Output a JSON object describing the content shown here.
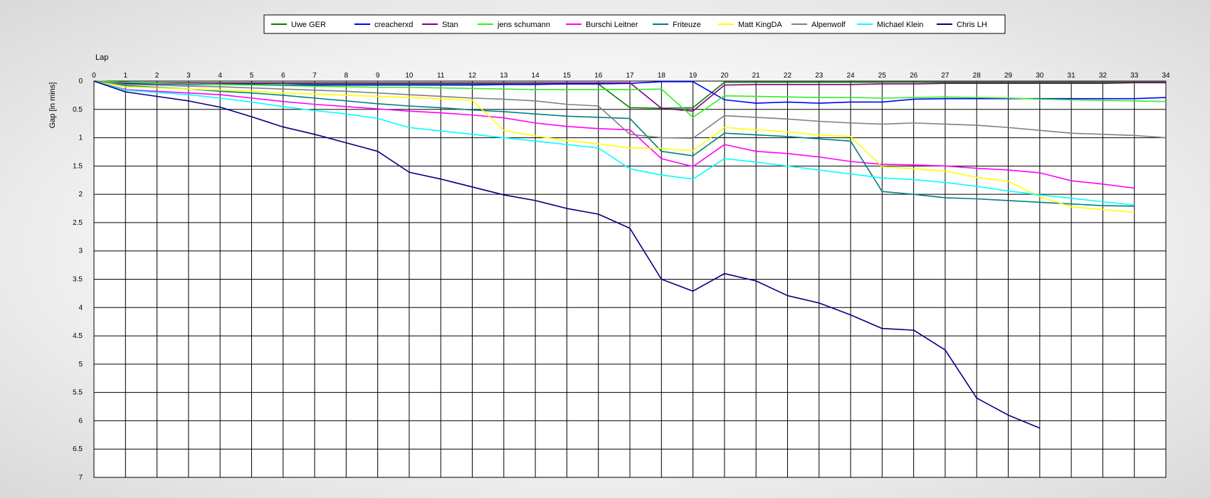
{
  "chart_data": {
    "type": "line",
    "xlabel": "Lap",
    "ylabel": "Gap [in mins]",
    "xlim": [
      0,
      34
    ],
    "ylim": [
      0,
      7
    ],
    "y_inverted": true,
    "x_ticks": [
      "0",
      "1",
      "2",
      "3",
      "4",
      "5",
      "6",
      "7",
      "8",
      "9",
      "10",
      "11",
      "12",
      "13",
      "14",
      "15",
      "16",
      "17",
      "18",
      "19",
      "20",
      "21",
      "22",
      "23",
      "24",
      "25",
      "26",
      "27",
      "28",
      "29",
      "30",
      "31",
      "32",
      "33",
      "34"
    ],
    "y_ticks": [
      "0",
      "0.5",
      "1",
      "1.5",
      "2",
      "2.5",
      "3",
      "3.5",
      "4",
      "4.5",
      "5",
      "5.5",
      "6",
      "6.5",
      "7"
    ],
    "grid": true,
    "legend_position": "top-center",
    "series": [
      {
        "name": "Uwe GER",
        "color": "#008000",
        "x": [
          0,
          1,
          2,
          3,
          4,
          5,
          6,
          7,
          8,
          9,
          10,
          11,
          12,
          13,
          14,
          15,
          16,
          17,
          18,
          19,
          20,
          21,
          22,
          23,
          24,
          25,
          26,
          27,
          28,
          29,
          30,
          31,
          32,
          33,
          34
        ],
        "y": [
          0,
          0.02,
          0.03,
          0.03,
          0.04,
          0.04,
          0.04,
          0.05,
          0.05,
          0.05,
          0.05,
          0.05,
          0.05,
          0.05,
          0.05,
          0.05,
          0.05,
          0.47,
          0.48,
          0.47,
          0.02,
          0.02,
          0.02,
          0.02,
          0.02,
          0.02,
          0.02,
          0.02,
          0.02,
          0.02,
          0.02,
          0.02,
          0.02,
          0.02,
          0.02
        ]
      },
      {
        "name": "creacherxd",
        "color": "#0000ff",
        "x": [
          0,
          1,
          2,
          3,
          4,
          5,
          6,
          7,
          8,
          9,
          10,
          11,
          12,
          13,
          14,
          15,
          16,
          17,
          18,
          19,
          20,
          21,
          22,
          23,
          24,
          25,
          26,
          27,
          28,
          29,
          30,
          31,
          32,
          33,
          34
        ],
        "y": [
          0,
          0.04,
          0.05,
          0.06,
          0.06,
          0.06,
          0.07,
          0.07,
          0.07,
          0.07,
          0.07,
          0.07,
          0.07,
          0.06,
          0.06,
          0.05,
          0.05,
          0.04,
          0.01,
          0.01,
          0.33,
          0.39,
          0.37,
          0.39,
          0.37,
          0.37,
          0.32,
          0.31,
          0.31,
          0.31,
          0.31,
          0.31,
          0.31,
          0.31,
          0.29
        ]
      },
      {
        "name": "Stan",
        "color": "#800080",
        "x": [
          0,
          1,
          2,
          3,
          4,
          5,
          6,
          7,
          8,
          9,
          10,
          11,
          12,
          13,
          14,
          15,
          16,
          17,
          18,
          19,
          20,
          21,
          22,
          23,
          24,
          25,
          26,
          27,
          28,
          29,
          30,
          31,
          32,
          33,
          34
        ],
        "y": [
          0,
          0.03,
          0.03,
          0.03,
          0.03,
          0.03,
          0.03,
          0.03,
          0.03,
          0.03,
          0.03,
          0.03,
          0.03,
          0.03,
          0.03,
          0.03,
          0.03,
          0.03,
          0.48,
          0.53,
          0.07,
          0.06,
          0.06,
          0.06,
          0.06,
          0.05,
          0.05,
          0.04,
          0.04,
          0.04,
          0.04,
          0.04,
          0.04,
          0.03,
          0.03
        ]
      },
      {
        "name": "jens  schumann",
        "color": "#33ee22",
        "x": [
          0,
          1,
          2,
          3,
          4,
          5,
          6,
          7,
          8,
          9,
          10,
          11,
          12,
          13,
          14,
          15,
          16,
          17,
          18,
          19,
          20,
          21,
          22,
          23,
          24,
          25,
          26,
          27,
          28,
          29,
          30,
          31,
          32,
          33,
          34
        ],
        "y": [
          0,
          0.02,
          0.04,
          0.05,
          0.06,
          0.07,
          0.08,
          0.09,
          0.1,
          0.11,
          0.11,
          0.12,
          0.13,
          0.14,
          0.15,
          0.15,
          0.15,
          0.15,
          0.14,
          0.64,
          0.26,
          0.27,
          0.28,
          0.29,
          0.29,
          0.3,
          0.29,
          0.28,
          0.29,
          0.3,
          0.32,
          0.33,
          0.34,
          0.35,
          0.36
        ]
      },
      {
        "name": "Burschi Leitner",
        "color": "#ff00ff",
        "x": [
          0,
          1,
          2,
          3,
          4,
          5,
          6,
          7,
          8,
          9,
          10,
          11,
          12,
          13,
          14,
          15,
          16,
          17,
          18,
          19,
          20,
          21,
          22,
          23,
          24,
          25,
          26,
          27,
          28,
          29,
          30,
          31,
          32,
          33
        ],
        "y": [
          0,
          0.15,
          0.18,
          0.21,
          0.24,
          0.3,
          0.36,
          0.41,
          0.45,
          0.49,
          0.53,
          0.56,
          0.6,
          0.65,
          0.74,
          0.8,
          0.84,
          0.86,
          1.37,
          1.51,
          1.12,
          1.24,
          1.28,
          1.34,
          1.42,
          1.47,
          1.48,
          1.5,
          1.54,
          1.57,
          1.62,
          1.76,
          1.82,
          1.89
        ]
      },
      {
        "name": "Friteuze",
        "color": "#008080",
        "x": [
          0,
          1,
          2,
          3,
          4,
          5,
          6,
          7,
          8,
          9,
          10,
          11,
          12,
          13,
          14,
          15,
          16,
          17,
          18,
          19,
          20,
          21,
          22,
          23,
          24,
          25,
          26,
          27,
          28,
          29,
          30,
          31,
          32,
          33
        ],
        "y": [
          0,
          0.08,
          0.11,
          0.14,
          0.18,
          0.21,
          0.25,
          0.3,
          0.35,
          0.4,
          0.44,
          0.47,
          0.51,
          0.54,
          0.58,
          0.62,
          0.64,
          0.66,
          1.24,
          1.32,
          0.92,
          0.95,
          0.98,
          1.02,
          1.06,
          1.95,
          2.0,
          2.06,
          2.08,
          2.11,
          2.14,
          2.17,
          2.2,
          2.21
        ]
      },
      {
        "name": "Matt KingDA",
        "color": "#ffff00",
        "x": [
          0,
          1,
          2,
          3,
          4,
          5,
          6,
          7,
          8,
          9,
          10,
          11,
          12,
          13,
          14,
          15,
          16,
          17,
          18,
          19,
          20,
          21,
          22,
          23,
          24,
          25,
          26,
          27,
          28,
          29,
          30,
          31,
          32,
          33
        ],
        "y": [
          0,
          0.1,
          0.12,
          0.14,
          0.16,
          0.18,
          0.21,
          0.23,
          0.25,
          0.27,
          0.29,
          0.31,
          0.34,
          0.87,
          0.97,
          1.05,
          1.11,
          1.18,
          1.19,
          1.23,
          0.82,
          0.86,
          0.9,
          0.95,
          0.98,
          1.51,
          1.55,
          1.59,
          1.7,
          1.77,
          2.04,
          2.22,
          2.27,
          2.32
        ]
      },
      {
        "name": "Alpenwolf",
        "color": "#808080",
        "x": [
          0,
          1,
          2,
          3,
          4,
          5,
          6,
          7,
          8,
          9,
          10,
          11,
          12,
          13,
          14,
          15,
          16,
          17,
          18,
          19,
          20,
          21,
          22,
          23,
          24,
          25,
          26,
          27,
          28,
          29,
          30,
          31,
          32,
          33,
          34
        ],
        "y": [
          0,
          0.06,
          0.07,
          0.09,
          0.1,
          0.12,
          0.14,
          0.16,
          0.18,
          0.21,
          0.24,
          0.27,
          0.3,
          0.32,
          0.35,
          0.41,
          0.44,
          0.94,
          1.0,
          1.01,
          0.61,
          0.64,
          0.67,
          0.71,
          0.74,
          0.76,
          0.74,
          0.76,
          0.78,
          0.82,
          0.87,
          0.92,
          0.94,
          0.96,
          1.0
        ]
      },
      {
        "name": "Michael Klein",
        "color": "#00ffff",
        "x": [
          0,
          1,
          2,
          3,
          4,
          5,
          6,
          7,
          8,
          9,
          10,
          11,
          12,
          13,
          14,
          15,
          16,
          17,
          18,
          19,
          20,
          21,
          22,
          23,
          24,
          25,
          26,
          27,
          28,
          29,
          30,
          31,
          32,
          33
        ],
        "y": [
          0,
          0.16,
          0.2,
          0.24,
          0.3,
          0.37,
          0.45,
          0.52,
          0.58,
          0.66,
          0.82,
          0.88,
          0.94,
          1.0,
          1.06,
          1.12,
          1.18,
          1.55,
          1.66,
          1.73,
          1.37,
          1.43,
          1.5,
          1.57,
          1.64,
          1.71,
          1.74,
          1.79,
          1.86,
          1.94,
          2.01,
          2.07,
          2.13,
          2.19
        ]
      },
      {
        "name": "Chris LH",
        "color": "#000080",
        "x": [
          0,
          1,
          2,
          3,
          4,
          5,
          6,
          7,
          8,
          9,
          10,
          11,
          12,
          13,
          14,
          15,
          16,
          17,
          18,
          19,
          20,
          21,
          22,
          23,
          24,
          25,
          26,
          27,
          28,
          29,
          30
        ],
        "y": [
          0,
          0.19,
          0.27,
          0.35,
          0.46,
          0.63,
          0.81,
          0.94,
          1.09,
          1.24,
          1.61,
          1.73,
          1.87,
          2.01,
          2.11,
          2.25,
          2.35,
          2.6,
          3.5,
          3.71,
          3.4,
          3.53,
          3.79,
          3.92,
          4.13,
          4.37,
          4.4,
          4.75,
          5.6,
          5.9,
          6.13
        ]
      }
    ]
  }
}
